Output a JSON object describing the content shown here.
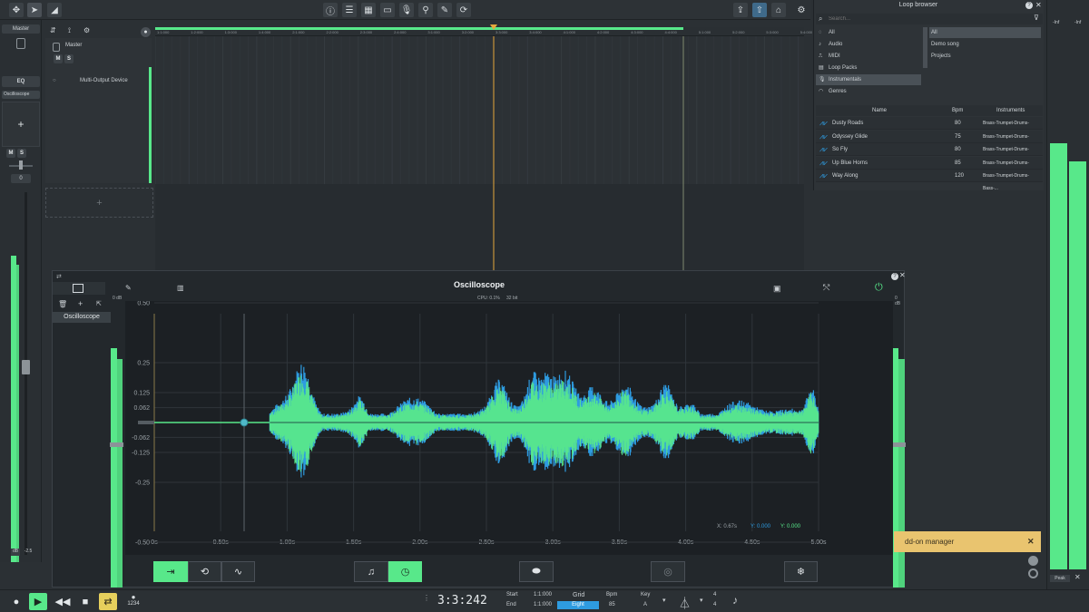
{
  "toolbar": {
    "icons": [
      "move-icon",
      "pointer-icon",
      "automation-icon",
      "info-icon",
      "mixer-icon",
      "keyboard-icon",
      "piano-icon",
      "microphone-icon",
      "edit-icon",
      "loop-icon",
      "tuner-icon",
      "upload-icon",
      "home-icon",
      "settings-icon"
    ]
  },
  "left_strip": {
    "label_top": "Master",
    "eq_label": "EQ",
    "plugin_label": "Oscilloscope",
    "add_symbol": "+",
    "m_label": "M",
    "s_label": "S",
    "gain_value": "0",
    "db_readout": "-2.5"
  },
  "track": {
    "name": "Master",
    "m_label": "M",
    "s_label": "S",
    "device": "Multi-Output Device",
    "add_track": "+"
  },
  "ruler_ticks": [
    "1:1:000",
    "1:2:000",
    "1:3:000",
    "1:4:000",
    "2:1:000",
    "2:2:000",
    "2:3:000",
    "2:4:000",
    "3:1:000",
    "3:2:000",
    "3:3:000",
    "3:4:000",
    "4:1:000",
    "4:2:000",
    "4:3:000",
    "4:4:000",
    "5:1:000",
    "5:2:000",
    "5:3:000",
    "5:4:000"
  ],
  "loop_browser": {
    "title": "Loop browser",
    "search_placeholder": "Search...",
    "categories": [
      "All",
      "Audio",
      "MIDI",
      "Loop Packs",
      "Instrumentals",
      "Genres"
    ],
    "selected_category": "Instrumentals",
    "subcategories": [
      "All",
      "Demo song",
      "Projects"
    ],
    "columns": [
      "Name",
      "Bpm",
      "Instruments"
    ],
    "rows": [
      {
        "name": "Dusty Roads",
        "bpm": "80",
        "instruments": "Brass-Trumpet-Drums-Bass-..."
      },
      {
        "name": "Odyssey Glide",
        "bpm": "75",
        "instruments": "Brass-Trumpet-Drums-Bass-..."
      },
      {
        "name": "So Fly",
        "bpm": "80",
        "instruments": "Brass-Trumpet-Drums-Bass-..."
      },
      {
        "name": "Up Blue Horns",
        "bpm": "85",
        "instruments": "Brass-Trumpet-Drums-Bass-..."
      },
      {
        "name": "Way Along",
        "bpm": "120",
        "instruments": "Brass-Trumpet-Drums-Bass-..."
      }
    ]
  },
  "right_meter": {
    "top_left": "-Inf",
    "top_right": "-Inf",
    "peak_label": "Peak"
  },
  "oscilloscope": {
    "title": "Oscilloscope",
    "cpu": "CPU: 0.1%",
    "bit": "32 bit",
    "left_db": "0 dB",
    "right_db": "0 dB",
    "plugin_item": "Oscilloscope",
    "readout_x": "X: 0.67s",
    "readout_y1": "Y: 0.000",
    "readout_y2": "Y: 0.000",
    "y_ticks": [
      "0.50",
      "0.25",
      "0.125",
      "0.062",
      "-0.062",
      "-0.125",
      "-0.25",
      "-0.50"
    ],
    "x_ticks": [
      "0s",
      "0.50s",
      "1.00s",
      "1.50s",
      "2.00s",
      "2.50s",
      "3.00s",
      "3.50s",
      "4.00s",
      "4.50s",
      "5.00s"
    ],
    "accent": "#58e88a",
    "wave_blue": "#2e9be0"
  },
  "toast": {
    "text": "dd-on manager",
    "close": "✕"
  },
  "transport": {
    "position": "3:3:242",
    "start_label": "Start",
    "end_label": "End",
    "start_value": "1:1:000",
    "end_value": "1:1:000",
    "grid_label": "Grid",
    "grid_value": "Eight",
    "bpm_label": "Bpm",
    "bpm_value": "85",
    "key_label": "Key",
    "key_value": "A",
    "sig_top": "4",
    "sig_bottom": "4",
    "count_in": "1234"
  }
}
